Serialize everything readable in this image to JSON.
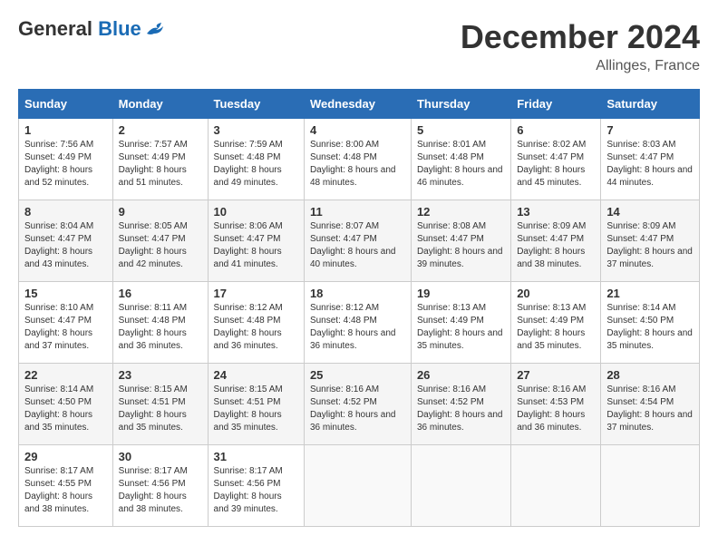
{
  "header": {
    "logo_general": "General",
    "logo_blue": "Blue",
    "title": "December 2024",
    "location": "Allinges, France"
  },
  "weekdays": [
    "Sunday",
    "Monday",
    "Tuesday",
    "Wednesday",
    "Thursday",
    "Friday",
    "Saturday"
  ],
  "weeks": [
    [
      {
        "day": "1",
        "sunrise": "Sunrise: 7:56 AM",
        "sunset": "Sunset: 4:49 PM",
        "daylight": "Daylight: 8 hours and 52 minutes."
      },
      {
        "day": "2",
        "sunrise": "Sunrise: 7:57 AM",
        "sunset": "Sunset: 4:49 PM",
        "daylight": "Daylight: 8 hours and 51 minutes."
      },
      {
        "day": "3",
        "sunrise": "Sunrise: 7:59 AM",
        "sunset": "Sunset: 4:48 PM",
        "daylight": "Daylight: 8 hours and 49 minutes."
      },
      {
        "day": "4",
        "sunrise": "Sunrise: 8:00 AM",
        "sunset": "Sunset: 4:48 PM",
        "daylight": "Daylight: 8 hours and 48 minutes."
      },
      {
        "day": "5",
        "sunrise": "Sunrise: 8:01 AM",
        "sunset": "Sunset: 4:48 PM",
        "daylight": "Daylight: 8 hours and 46 minutes."
      },
      {
        "day": "6",
        "sunrise": "Sunrise: 8:02 AM",
        "sunset": "Sunset: 4:47 PM",
        "daylight": "Daylight: 8 hours and 45 minutes."
      },
      {
        "day": "7",
        "sunrise": "Sunrise: 8:03 AM",
        "sunset": "Sunset: 4:47 PM",
        "daylight": "Daylight: 8 hours and 44 minutes."
      }
    ],
    [
      {
        "day": "8",
        "sunrise": "Sunrise: 8:04 AM",
        "sunset": "Sunset: 4:47 PM",
        "daylight": "Daylight: 8 hours and 43 minutes."
      },
      {
        "day": "9",
        "sunrise": "Sunrise: 8:05 AM",
        "sunset": "Sunset: 4:47 PM",
        "daylight": "Daylight: 8 hours and 42 minutes."
      },
      {
        "day": "10",
        "sunrise": "Sunrise: 8:06 AM",
        "sunset": "Sunset: 4:47 PM",
        "daylight": "Daylight: 8 hours and 41 minutes."
      },
      {
        "day": "11",
        "sunrise": "Sunrise: 8:07 AM",
        "sunset": "Sunset: 4:47 PM",
        "daylight": "Daylight: 8 hours and 40 minutes."
      },
      {
        "day": "12",
        "sunrise": "Sunrise: 8:08 AM",
        "sunset": "Sunset: 4:47 PM",
        "daylight": "Daylight: 8 hours and 39 minutes."
      },
      {
        "day": "13",
        "sunrise": "Sunrise: 8:09 AM",
        "sunset": "Sunset: 4:47 PM",
        "daylight": "Daylight: 8 hours and 38 minutes."
      },
      {
        "day": "14",
        "sunrise": "Sunrise: 8:09 AM",
        "sunset": "Sunset: 4:47 PM",
        "daylight": "Daylight: 8 hours and 37 minutes."
      }
    ],
    [
      {
        "day": "15",
        "sunrise": "Sunrise: 8:10 AM",
        "sunset": "Sunset: 4:47 PM",
        "daylight": "Daylight: 8 hours and 37 minutes."
      },
      {
        "day": "16",
        "sunrise": "Sunrise: 8:11 AM",
        "sunset": "Sunset: 4:48 PM",
        "daylight": "Daylight: 8 hours and 36 minutes."
      },
      {
        "day": "17",
        "sunrise": "Sunrise: 8:12 AM",
        "sunset": "Sunset: 4:48 PM",
        "daylight": "Daylight: 8 hours and 36 minutes."
      },
      {
        "day": "18",
        "sunrise": "Sunrise: 8:12 AM",
        "sunset": "Sunset: 4:48 PM",
        "daylight": "Daylight: 8 hours and 36 minutes."
      },
      {
        "day": "19",
        "sunrise": "Sunrise: 8:13 AM",
        "sunset": "Sunset: 4:49 PM",
        "daylight": "Daylight: 8 hours and 35 minutes."
      },
      {
        "day": "20",
        "sunrise": "Sunrise: 8:13 AM",
        "sunset": "Sunset: 4:49 PM",
        "daylight": "Daylight: 8 hours and 35 minutes."
      },
      {
        "day": "21",
        "sunrise": "Sunrise: 8:14 AM",
        "sunset": "Sunset: 4:50 PM",
        "daylight": "Daylight: 8 hours and 35 minutes."
      }
    ],
    [
      {
        "day": "22",
        "sunrise": "Sunrise: 8:14 AM",
        "sunset": "Sunset: 4:50 PM",
        "daylight": "Daylight: 8 hours and 35 minutes."
      },
      {
        "day": "23",
        "sunrise": "Sunrise: 8:15 AM",
        "sunset": "Sunset: 4:51 PM",
        "daylight": "Daylight: 8 hours and 35 minutes."
      },
      {
        "day": "24",
        "sunrise": "Sunrise: 8:15 AM",
        "sunset": "Sunset: 4:51 PM",
        "daylight": "Daylight: 8 hours and 35 minutes."
      },
      {
        "day": "25",
        "sunrise": "Sunrise: 8:16 AM",
        "sunset": "Sunset: 4:52 PM",
        "daylight": "Daylight: 8 hours and 36 minutes."
      },
      {
        "day": "26",
        "sunrise": "Sunrise: 8:16 AM",
        "sunset": "Sunset: 4:52 PM",
        "daylight": "Daylight: 8 hours and 36 minutes."
      },
      {
        "day": "27",
        "sunrise": "Sunrise: 8:16 AM",
        "sunset": "Sunset: 4:53 PM",
        "daylight": "Daylight: 8 hours and 36 minutes."
      },
      {
        "day": "28",
        "sunrise": "Sunrise: 8:16 AM",
        "sunset": "Sunset: 4:54 PM",
        "daylight": "Daylight: 8 hours and 37 minutes."
      }
    ],
    [
      {
        "day": "29",
        "sunrise": "Sunrise: 8:17 AM",
        "sunset": "Sunset: 4:55 PM",
        "daylight": "Daylight: 8 hours and 38 minutes."
      },
      {
        "day": "30",
        "sunrise": "Sunrise: 8:17 AM",
        "sunset": "Sunset: 4:56 PM",
        "daylight": "Daylight: 8 hours and 38 minutes."
      },
      {
        "day": "31",
        "sunrise": "Sunrise: 8:17 AM",
        "sunset": "Sunset: 4:56 PM",
        "daylight": "Daylight: 8 hours and 39 minutes."
      },
      null,
      null,
      null,
      null
    ]
  ]
}
